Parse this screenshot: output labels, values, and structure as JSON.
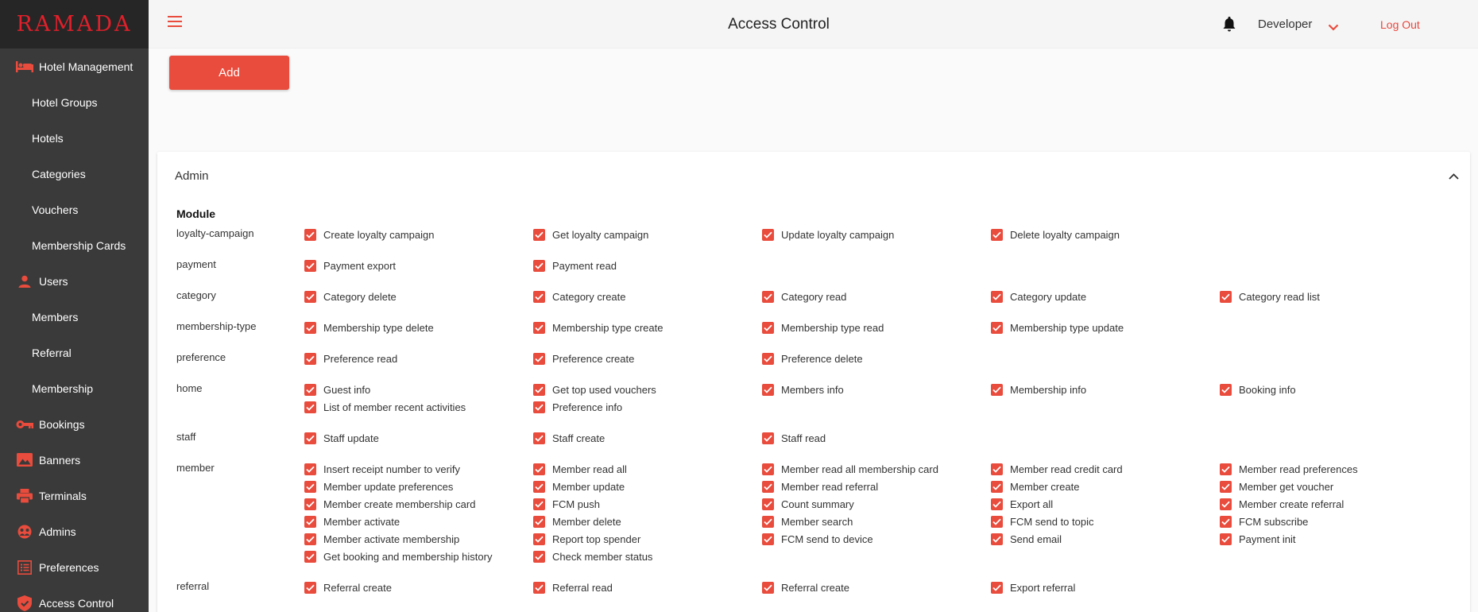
{
  "app": {
    "logo": "RAMADA",
    "title": "Access Control"
  },
  "topbar": {
    "user": "Developer",
    "logout": "Log Out"
  },
  "sidebar": {
    "items": [
      {
        "label": "Hotel Management",
        "type": "section",
        "icon": "bed-icon"
      },
      {
        "label": "Hotel Groups",
        "type": "sub"
      },
      {
        "label": "Hotels",
        "type": "sub"
      },
      {
        "label": "Categories",
        "type": "sub"
      },
      {
        "label": "Vouchers",
        "type": "sub"
      },
      {
        "label": "Membership Cards",
        "type": "sub"
      },
      {
        "label": "Users",
        "type": "section",
        "icon": "person-icon"
      },
      {
        "label": "Members",
        "type": "sub"
      },
      {
        "label": "Referral",
        "type": "sub"
      },
      {
        "label": "Membership",
        "type": "sub"
      },
      {
        "label": "Bookings",
        "type": "section",
        "icon": "key-icon"
      },
      {
        "label": "Banners",
        "type": "section",
        "icon": "image-icon"
      },
      {
        "label": "Terminals",
        "type": "section",
        "icon": "printer-icon"
      },
      {
        "label": "Admins",
        "type": "section",
        "icon": "admin-icon"
      },
      {
        "label": "Preferences",
        "type": "section",
        "icon": "list-icon"
      },
      {
        "label": "Access Control",
        "type": "section",
        "icon": "shield-icon"
      }
    ]
  },
  "main": {
    "add_label": "Add",
    "panel_title": "Admin",
    "module_header": "Module",
    "modules": [
      {
        "name": "loyalty-campaign",
        "perms": [
          "Create loyalty campaign",
          "Get loyalty campaign",
          "Update loyalty campaign",
          "Delete loyalty campaign"
        ]
      },
      {
        "name": "payment",
        "perms": [
          "Payment export",
          "Payment read"
        ]
      },
      {
        "name": "category",
        "perms": [
          "Category delete",
          "Category create",
          "Category read",
          "Category update",
          "Category read list"
        ]
      },
      {
        "name": "membership-type",
        "perms": [
          "Membership type delete",
          "Membership type create",
          "Membership type read",
          "Membership type update"
        ]
      },
      {
        "name": "preference",
        "perms": [
          "Preference read",
          "Preference create",
          "Preference delete"
        ]
      },
      {
        "name": "home",
        "perms": [
          "Guest info",
          "Get top used vouchers",
          "Members info",
          "Membership info",
          "Booking info",
          "List of member recent activities",
          "Preference info"
        ]
      },
      {
        "name": "staff",
        "perms": [
          "Staff update",
          "Staff create",
          "Staff read"
        ]
      },
      {
        "name": "member",
        "perms": [
          "Insert receipt number to verify",
          "Member read all",
          "Member read all membership card",
          "Member read credit card",
          "Member read preferences",
          "Member update preferences",
          "Member update",
          "Member read referral",
          "Member create",
          "Member get voucher",
          "Member create membership card",
          "FCM push",
          "Count summary",
          "Export all",
          "Member create referral",
          "Member activate",
          "Member delete",
          "Member search",
          "FCM send to topic",
          "FCM subscribe",
          "Member activate membership",
          "Report top spender",
          "FCM send to device",
          "Send email",
          "Payment init",
          "Get booking and membership history",
          "Check member status"
        ]
      },
      {
        "name": "referral",
        "perms": [
          "Referral create",
          "Referral read",
          "Referral create",
          "Export referral"
        ]
      }
    ]
  },
  "colors": {
    "accent": "#e94b3c",
    "sidebar": "#3a3a3a",
    "sidebar_top": "#262626",
    "logo": "#e0202a"
  }
}
